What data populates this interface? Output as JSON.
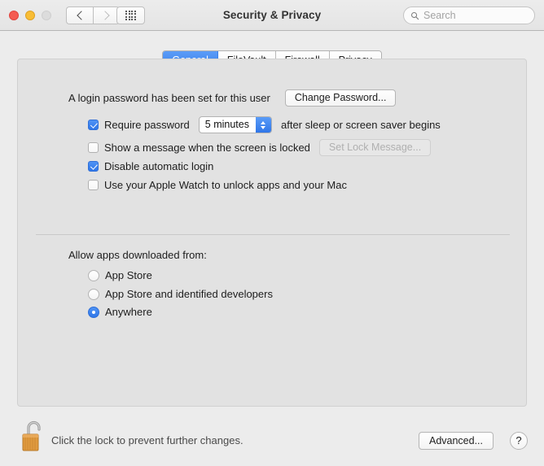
{
  "window": {
    "title": "Security & Privacy",
    "traffic_lights": [
      "close-red",
      "minimize-yellow",
      "zoom-disabled"
    ],
    "nav": {
      "back_icon": "chevron-left-icon",
      "forward_icon": "chevron-right-icon",
      "show_all_icon": "grid-dots-icon"
    },
    "search": {
      "placeholder": "Search",
      "value": "",
      "icon": "search-icon"
    }
  },
  "tabs": [
    {
      "label": "General",
      "active": true
    },
    {
      "label": "FileVault",
      "active": false
    },
    {
      "label": "Firewall",
      "active": false
    },
    {
      "label": "Privacy",
      "active": false
    }
  ],
  "general": {
    "password_status": "A login password has been set for this user",
    "change_password_button": "Change Password...",
    "require_password": {
      "label_before": "Require password",
      "checked": true,
      "interval_value": "5 minutes",
      "label_after": "after sleep or screen saver begins",
      "stepper_icon": "chevron-up-down-icon"
    },
    "show_message": {
      "label": "Show a message when the screen is locked",
      "checked": false,
      "button": "Set Lock Message...",
      "button_disabled": true
    },
    "disable_auto_login": {
      "label": "Disable automatic login",
      "checked": true
    },
    "apple_watch": {
      "label": "Use your Apple Watch to unlock apps and your Mac",
      "checked": false
    },
    "gatekeeper": {
      "heading": "Allow apps downloaded from:",
      "options": [
        {
          "label": "App Store",
          "selected": false
        },
        {
          "label": "App Store and identified developers",
          "selected": false
        },
        {
          "label": "Anywhere",
          "selected": true
        }
      ]
    }
  },
  "bottom": {
    "lock_icon": "padlock-open-icon",
    "lock_text": "Click the lock to prevent further changes.",
    "advanced_button": "Advanced...",
    "help_button": "?"
  },
  "colors": {
    "accent": "#2f76e8",
    "window_bg": "#ececec",
    "panel_bg": "#e2e2e2",
    "lock_body": "#e09a3e"
  }
}
